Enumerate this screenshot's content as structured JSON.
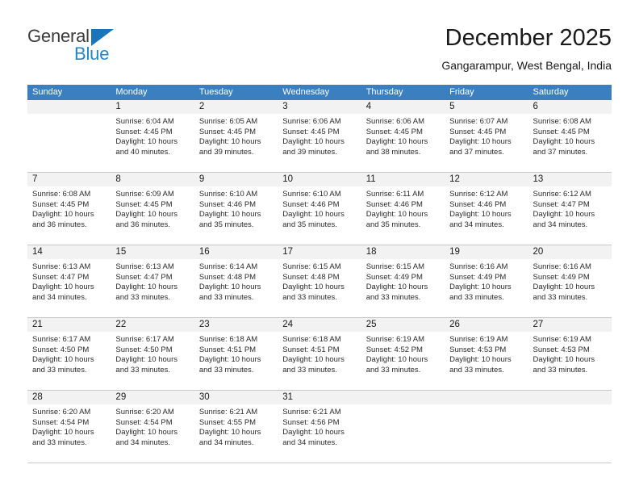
{
  "logo": {
    "word_top": "General",
    "word_bottom": "Blue",
    "triangle_color": "#1b73ba",
    "blue_color": "#2585c7",
    "gray_color": "#3c3c3c"
  },
  "header": {
    "title": "December 2025",
    "subtitle": "Gangarampur, West Bengal, India"
  },
  "theme": {
    "header_row_bg": "#3b7fbf",
    "header_row_text": "#ffffff",
    "day_band_bg": "#f2f2f2",
    "grid_line": "#c8c8c8"
  },
  "weekdays": [
    "Sunday",
    "Monday",
    "Tuesday",
    "Wednesday",
    "Thursday",
    "Friday",
    "Saturday"
  ],
  "weeks": [
    [
      {
        "day": "",
        "sunrise": "",
        "sunset": "",
        "daylight_line1": "",
        "daylight_line2": ""
      },
      {
        "day": "1",
        "sunrise": "Sunrise: 6:04 AM",
        "sunset": "Sunset: 4:45 PM",
        "daylight_line1": "Daylight: 10 hours",
        "daylight_line2": "and 40 minutes."
      },
      {
        "day": "2",
        "sunrise": "Sunrise: 6:05 AM",
        "sunset": "Sunset: 4:45 PM",
        "daylight_line1": "Daylight: 10 hours",
        "daylight_line2": "and 39 minutes."
      },
      {
        "day": "3",
        "sunrise": "Sunrise: 6:06 AM",
        "sunset": "Sunset: 4:45 PM",
        "daylight_line1": "Daylight: 10 hours",
        "daylight_line2": "and 39 minutes."
      },
      {
        "day": "4",
        "sunrise": "Sunrise: 6:06 AM",
        "sunset": "Sunset: 4:45 PM",
        "daylight_line1": "Daylight: 10 hours",
        "daylight_line2": "and 38 minutes."
      },
      {
        "day": "5",
        "sunrise": "Sunrise: 6:07 AM",
        "sunset": "Sunset: 4:45 PM",
        "daylight_line1": "Daylight: 10 hours",
        "daylight_line2": "and 37 minutes."
      },
      {
        "day": "6",
        "sunrise": "Sunrise: 6:08 AM",
        "sunset": "Sunset: 4:45 PM",
        "daylight_line1": "Daylight: 10 hours",
        "daylight_line2": "and 37 minutes."
      }
    ],
    [
      {
        "day": "7",
        "sunrise": "Sunrise: 6:08 AM",
        "sunset": "Sunset: 4:45 PM",
        "daylight_line1": "Daylight: 10 hours",
        "daylight_line2": "and 36 minutes."
      },
      {
        "day": "8",
        "sunrise": "Sunrise: 6:09 AM",
        "sunset": "Sunset: 4:45 PM",
        "daylight_line1": "Daylight: 10 hours",
        "daylight_line2": "and 36 minutes."
      },
      {
        "day": "9",
        "sunrise": "Sunrise: 6:10 AM",
        "sunset": "Sunset: 4:46 PM",
        "daylight_line1": "Daylight: 10 hours",
        "daylight_line2": "and 35 minutes."
      },
      {
        "day": "10",
        "sunrise": "Sunrise: 6:10 AM",
        "sunset": "Sunset: 4:46 PM",
        "daylight_line1": "Daylight: 10 hours",
        "daylight_line2": "and 35 minutes."
      },
      {
        "day": "11",
        "sunrise": "Sunrise: 6:11 AM",
        "sunset": "Sunset: 4:46 PM",
        "daylight_line1": "Daylight: 10 hours",
        "daylight_line2": "and 35 minutes."
      },
      {
        "day": "12",
        "sunrise": "Sunrise: 6:12 AM",
        "sunset": "Sunset: 4:46 PM",
        "daylight_line1": "Daylight: 10 hours",
        "daylight_line2": "and 34 minutes."
      },
      {
        "day": "13",
        "sunrise": "Sunrise: 6:12 AM",
        "sunset": "Sunset: 4:47 PM",
        "daylight_line1": "Daylight: 10 hours",
        "daylight_line2": "and 34 minutes."
      }
    ],
    [
      {
        "day": "14",
        "sunrise": "Sunrise: 6:13 AM",
        "sunset": "Sunset: 4:47 PM",
        "daylight_line1": "Daylight: 10 hours",
        "daylight_line2": "and 34 minutes."
      },
      {
        "day": "15",
        "sunrise": "Sunrise: 6:13 AM",
        "sunset": "Sunset: 4:47 PM",
        "daylight_line1": "Daylight: 10 hours",
        "daylight_line2": "and 33 minutes."
      },
      {
        "day": "16",
        "sunrise": "Sunrise: 6:14 AM",
        "sunset": "Sunset: 4:48 PM",
        "daylight_line1": "Daylight: 10 hours",
        "daylight_line2": "and 33 minutes."
      },
      {
        "day": "17",
        "sunrise": "Sunrise: 6:15 AM",
        "sunset": "Sunset: 4:48 PM",
        "daylight_line1": "Daylight: 10 hours",
        "daylight_line2": "and 33 minutes."
      },
      {
        "day": "18",
        "sunrise": "Sunrise: 6:15 AM",
        "sunset": "Sunset: 4:49 PM",
        "daylight_line1": "Daylight: 10 hours",
        "daylight_line2": "and 33 minutes."
      },
      {
        "day": "19",
        "sunrise": "Sunrise: 6:16 AM",
        "sunset": "Sunset: 4:49 PM",
        "daylight_line1": "Daylight: 10 hours",
        "daylight_line2": "and 33 minutes."
      },
      {
        "day": "20",
        "sunrise": "Sunrise: 6:16 AM",
        "sunset": "Sunset: 4:49 PM",
        "daylight_line1": "Daylight: 10 hours",
        "daylight_line2": "and 33 minutes."
      }
    ],
    [
      {
        "day": "21",
        "sunrise": "Sunrise: 6:17 AM",
        "sunset": "Sunset: 4:50 PM",
        "daylight_line1": "Daylight: 10 hours",
        "daylight_line2": "and 33 minutes."
      },
      {
        "day": "22",
        "sunrise": "Sunrise: 6:17 AM",
        "sunset": "Sunset: 4:50 PM",
        "daylight_line1": "Daylight: 10 hours",
        "daylight_line2": "and 33 minutes."
      },
      {
        "day": "23",
        "sunrise": "Sunrise: 6:18 AM",
        "sunset": "Sunset: 4:51 PM",
        "daylight_line1": "Daylight: 10 hours",
        "daylight_line2": "and 33 minutes."
      },
      {
        "day": "24",
        "sunrise": "Sunrise: 6:18 AM",
        "sunset": "Sunset: 4:51 PM",
        "daylight_line1": "Daylight: 10 hours",
        "daylight_line2": "and 33 minutes."
      },
      {
        "day": "25",
        "sunrise": "Sunrise: 6:19 AM",
        "sunset": "Sunset: 4:52 PM",
        "daylight_line1": "Daylight: 10 hours",
        "daylight_line2": "and 33 minutes."
      },
      {
        "day": "26",
        "sunrise": "Sunrise: 6:19 AM",
        "sunset": "Sunset: 4:53 PM",
        "daylight_line1": "Daylight: 10 hours",
        "daylight_line2": "and 33 minutes."
      },
      {
        "day": "27",
        "sunrise": "Sunrise: 6:19 AM",
        "sunset": "Sunset: 4:53 PM",
        "daylight_line1": "Daylight: 10 hours",
        "daylight_line2": "and 33 minutes."
      }
    ],
    [
      {
        "day": "28",
        "sunrise": "Sunrise: 6:20 AM",
        "sunset": "Sunset: 4:54 PM",
        "daylight_line1": "Daylight: 10 hours",
        "daylight_line2": "and 33 minutes."
      },
      {
        "day": "29",
        "sunrise": "Sunrise: 6:20 AM",
        "sunset": "Sunset: 4:54 PM",
        "daylight_line1": "Daylight: 10 hours",
        "daylight_line2": "and 34 minutes."
      },
      {
        "day": "30",
        "sunrise": "Sunrise: 6:21 AM",
        "sunset": "Sunset: 4:55 PM",
        "daylight_line1": "Daylight: 10 hours",
        "daylight_line2": "and 34 minutes."
      },
      {
        "day": "31",
        "sunrise": "Sunrise: 6:21 AM",
        "sunset": "Sunset: 4:56 PM",
        "daylight_line1": "Daylight: 10 hours",
        "daylight_line2": "and 34 minutes."
      },
      {
        "day": "",
        "sunrise": "",
        "sunset": "",
        "daylight_line1": "",
        "daylight_line2": ""
      },
      {
        "day": "",
        "sunrise": "",
        "sunset": "",
        "daylight_line1": "",
        "daylight_line2": ""
      },
      {
        "day": "",
        "sunrise": "",
        "sunset": "",
        "daylight_line1": "",
        "daylight_line2": ""
      }
    ]
  ]
}
